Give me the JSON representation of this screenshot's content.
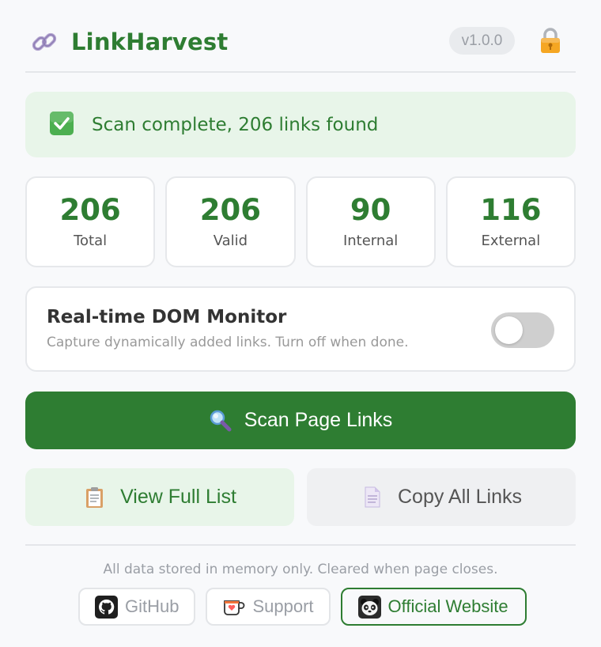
{
  "header": {
    "logo_icon": "link-icon",
    "title": "LinkHarvest",
    "version": "v1.0.0",
    "lock_icon": "lock-icon"
  },
  "status": {
    "icon": "check-icon",
    "text": "Scan complete, 206 links found"
  },
  "stats": [
    {
      "value": "206",
      "label": "Total"
    },
    {
      "value": "206",
      "label": "Valid"
    },
    {
      "value": "90",
      "label": "Internal"
    },
    {
      "value": "116",
      "label": "External"
    }
  ],
  "monitor": {
    "title": "Real-time DOM Monitor",
    "description": "Capture dynamically added links. Turn off when done.",
    "enabled": false
  },
  "actions": {
    "scan_label": "Scan Page Links",
    "scan_icon": "magnifier-icon",
    "view_label": "View Full List",
    "view_icon": "clipboard-icon",
    "copy_label": "Copy All Links",
    "copy_icon": "document-icon"
  },
  "footer": {
    "note": "All data stored in memory only. Cleared when page closes.",
    "links": [
      {
        "label": "GitHub",
        "icon": "github-icon"
      },
      {
        "label": "Support",
        "icon": "kofi-cup-icon"
      },
      {
        "label": "Official Website",
        "icon": "panda-icon"
      }
    ]
  },
  "colors": {
    "accent": "#2e7d32",
    "accent_light": "#e8f5e9",
    "muted": "#9a9ea5",
    "toggle_off": "#cfcfcf"
  }
}
